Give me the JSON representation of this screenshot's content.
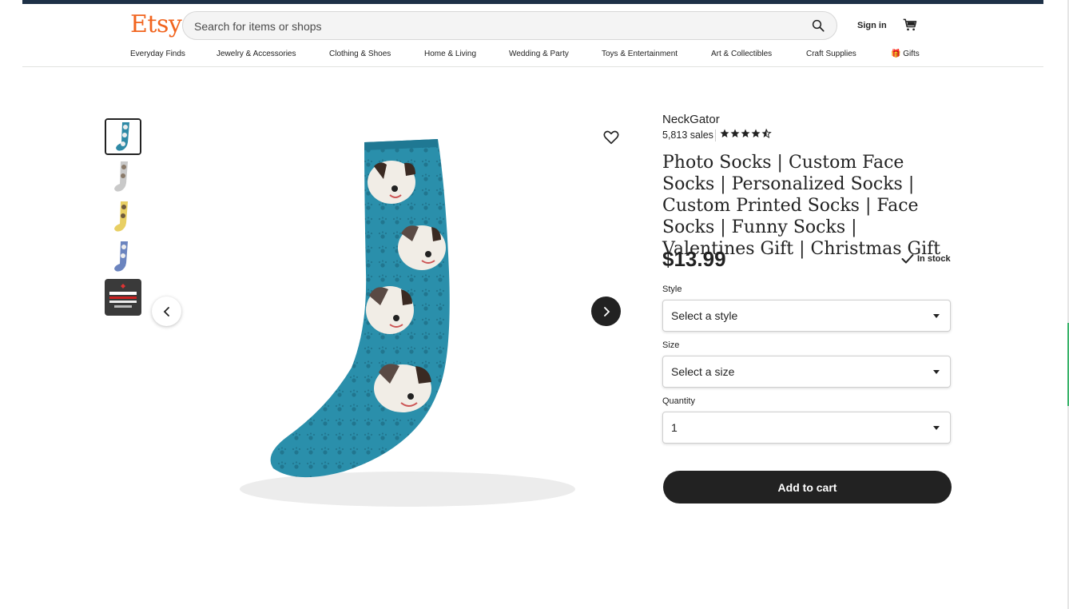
{
  "header": {
    "logo": "Etsy",
    "search_placeholder": "Search for items or shops",
    "sign_in": "Sign in"
  },
  "nav": {
    "items": [
      "Everyday Finds",
      "Jewelry & Accessories",
      "Clothing & Shoes",
      "Home & Living",
      "Wedding & Party",
      "Toys & Entertainment",
      "Art & Collectibles",
      "Craft Supplies",
      "Gifts"
    ]
  },
  "gallery": {
    "thumbnail_colors": [
      "#2f8aa6",
      "#c9c9c9",
      "#e8cf63",
      "#6b84bf",
      "#3a3a3a"
    ],
    "main_sock_color": "#2a8fab"
  },
  "product": {
    "shop_name": "NeckGator",
    "sales": "5,813 sales",
    "rating_stars": 4.5,
    "title": "Photo Socks | Custom Face Socks | Personalized Socks | Custom Printed Socks | Face Socks | Funny Socks | Valentines Gift | Christmas Gift",
    "price": "$13.99",
    "stock": "In stock",
    "style_label": "Style",
    "style_value": "Select a style",
    "size_label": "Size",
    "size_value": "Select a size",
    "quantity_label": "Quantity",
    "quantity_value": "1",
    "add_to_cart": "Add to cart"
  }
}
